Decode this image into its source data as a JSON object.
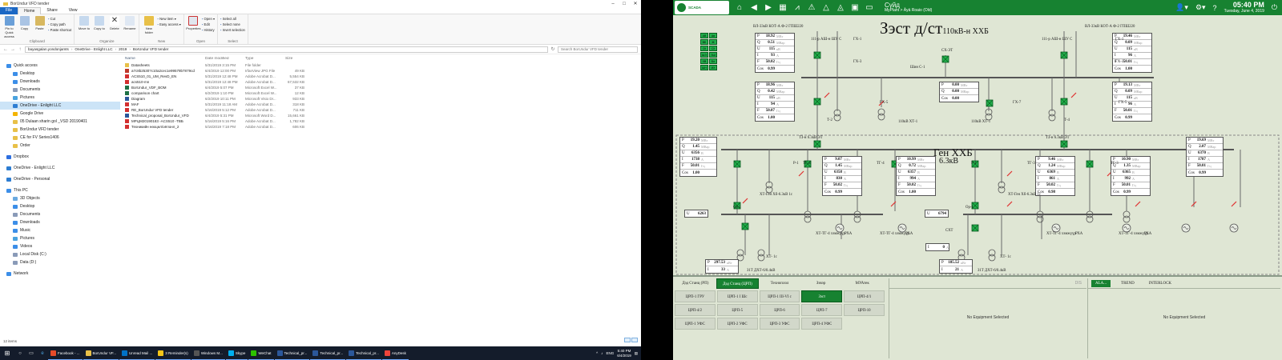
{
  "explorer": {
    "title": "BorUndur VFD tender",
    "tabs": [
      "File",
      "Home",
      "Share",
      "View"
    ],
    "ribbon": {
      "clipboard": {
        "label": "Clipboard",
        "pin": "Pin to Quick access",
        "copy": "Copy",
        "paste": "Paste",
        "cut": "Cut",
        "copy_path": "Copy path",
        "paste_shortcut": "Paste shortcut"
      },
      "organize": {
        "label": "Organize",
        "move": "Move to",
        "copy_to": "Copy to",
        "delete": "Delete",
        "rename": "Rename"
      },
      "new": {
        "label": "New",
        "new_folder": "New folder",
        "new_item": "New item ▾",
        "easy_access": "Easy access ▾"
      },
      "open": {
        "label": "Open",
        "properties": "Properties",
        "open": "Open ▾",
        "edit": "Edit",
        "history": "History"
      },
      "select": {
        "label": "Select",
        "select_all": "Select all",
        "select_none": "Select none",
        "invert": "Invert selection"
      }
    },
    "address": [
      "bayasgalan.yondonjamts",
      "OneDrive - Enlight LLC",
      "2019",
      "BorUndur VFD tender"
    ],
    "search_placeholder": "Search BorUndur VFD tender",
    "columns": {
      "name": "Name",
      "date": "Date modified",
      "type": "Type",
      "size": "Size"
    },
    "nav": [
      {
        "label": "Quick access",
        "color": "#3c8ee8",
        "indent": 0
      },
      {
        "label": "Desktop",
        "color": "#3c8ee8",
        "indent": 1
      },
      {
        "label": "Downloads",
        "color": "#3c8ee8",
        "indent": 1
      },
      {
        "label": "Documents",
        "color": "#8a9bb8",
        "indent": 1
      },
      {
        "label": "Pictures",
        "color": "#4aa3df",
        "indent": 1
      },
      {
        "label": "OneDrive - Enlight LLC",
        "color": "#2d7dd2",
        "indent": 1,
        "selected": true
      },
      {
        "label": "Google Drive",
        "color": "#f4b400",
        "indent": 1
      },
      {
        "label": "05 Dulaan sharin gol _VSD 20190401",
        "color": "#e8c048",
        "indent": 1
      },
      {
        "label": "BorUndur VFD tender",
        "color": "#e8c048",
        "indent": 1
      },
      {
        "label": "CE for FV Series1406",
        "color": "#e8c048",
        "indent": 1
      },
      {
        "label": "Order",
        "color": "#e8c048",
        "indent": 1
      },
      {
        "label": "Dropbox",
        "color": "#2d6fe0",
        "indent": 0
      },
      {
        "label": "OneDrive - Enlight LLC",
        "color": "#2d7dd2",
        "indent": 0
      },
      {
        "label": "OneDrive - Personal",
        "color": "#2d7dd2",
        "indent": 0
      },
      {
        "label": "This PC",
        "color": "#3c8ee8",
        "indent": 0
      },
      {
        "label": "3D Objects",
        "color": "#6aa9e0",
        "indent": 1
      },
      {
        "label": "Desktop",
        "color": "#3c8ee8",
        "indent": 1
      },
      {
        "label": "Documents",
        "color": "#8a9bb8",
        "indent": 1
      },
      {
        "label": "Downloads",
        "color": "#3c8ee8",
        "indent": 1
      },
      {
        "label": "Music",
        "color": "#3c8ee8",
        "indent": 1
      },
      {
        "label": "Pictures",
        "color": "#4aa3df",
        "indent": 1
      },
      {
        "label": "Videos",
        "color": "#3c8ee8",
        "indent": 1
      },
      {
        "label": "Local Disk (C:)",
        "color": "#8a9bb8",
        "indent": 1
      },
      {
        "label": "Data (D:)",
        "color": "#8a9bb8",
        "indent": 1
      },
      {
        "label": "Network",
        "color": "#3c8ee8",
        "indent": 0
      }
    ],
    "files": [
      {
        "name": "Datasheets",
        "date": "5/31/2019 3:15 PM",
        "type": "File folder",
        "size": "",
        "color": "#e8c048"
      },
      {
        "name": "a7c8b2530?c10a2cec1e99579b7879cd",
        "date": "6/4/2019 12:00 PM",
        "type": "IrfanView JPG File",
        "size": "49 KB",
        "color": "#c0392b"
      },
      {
        "name": "ACS510_01_UM_RevD_EN",
        "date": "5/31/2019 12:48 PM",
        "type": "Adobe Acrobat D...",
        "size": "5,554 KB",
        "color": "#d32f2f"
      },
      {
        "name": "acs510-mn",
        "date": "5/31/2019 12:48 PM",
        "type": "Adobe Acrobat D...",
        "size": "67,532 KB",
        "color": "#d32f2f"
      },
      {
        "name": "BorUndur_VDF_BOM",
        "date": "6/4/2019 5:07 PM",
        "type": "Microsoft Excel W...",
        "size": "37 KB",
        "color": "#1e7145"
      },
      {
        "name": "comparison chart",
        "date": "6/2/2019 1:10 PM",
        "type": "Microsoft Excel W...",
        "size": "12 KB",
        "color": "#1e7145"
      },
      {
        "name": "Diagram",
        "date": "6/2/2019 10:11 PM",
        "type": "Microsoft Visio Dr...",
        "size": "933 KB",
        "color": "#2b579a"
      },
      {
        "name": "MAF",
        "date": "5/31/2019 11:18 AM",
        "type": "Adobe Acrobat D...",
        "size": "318 KB",
        "color": "#d32f2f"
      },
      {
        "name": "RE_BorUndur VFD tender",
        "date": "5/16/2019 5:12 PM",
        "type": "Adobe Acrobat D...",
        "size": "711 KB",
        "color": "#d32f2f"
      },
      {
        "name": "Technical_proposal_BorUndur_VFD",
        "date": "6/4/2019 5:31 PM",
        "type": "Microsoft Word D...",
        "size": "15,661 KB",
        "color": "#2b579a"
      },
      {
        "name": "МРЦМ20190183 -ACS510 -TBБ",
        "date": "5/16/2019 5:16 PM",
        "type": "Adobe Acrobat D...",
        "size": "1,782 KB",
        "color": "#d32f2f"
      },
      {
        "name": "Техникийн нөхцөл/оёлонл_2",
        "date": "5/16/2019 7:18 PM",
        "type": "Adobe Acrobat D...",
        "size": "606 KB",
        "color": "#d32f2f"
      }
    ],
    "status": "12 items"
  },
  "taskbar": {
    "items": [
      {
        "label": "Facebook - ...",
        "color": "#e54b2a"
      },
      {
        "label": "BorUndur VF...",
        "color": "#e8c048"
      },
      {
        "label": "Unread Mail ...",
        "color": "#0072c6"
      },
      {
        "label": "3 Reminder(s)",
        "color": "#f5c518"
      },
      {
        "label": "Windows M...",
        "color": "#555555"
      },
      {
        "label": "Skype",
        "color": "#00aff0"
      },
      {
        "label": "WeChat",
        "color": "#2dc100"
      },
      {
        "label": "Technical_pr...",
        "color": "#2b579a"
      },
      {
        "label": "Technical_pr...",
        "color": "#2b579a"
      },
      {
        "label": "Technical_pr...",
        "color": "#2b579a"
      },
      {
        "label": "AnyDesk",
        "color": "#ef443b"
      }
    ],
    "lang": "ENG",
    "time": "5:40 PM",
    "date": "6/4/2019"
  },
  "scada": {
    "logo": "SCADA",
    "plant_line1": "Сүйд",
    "plant_line2": "MyPlant > Äyä Roaio (Old)",
    "time": "05:40 PM",
    "date": "Tuesday, June 4, 2019",
    "title": "Зэст д/ст",
    "subtitle": "110кВ-н ХХБ",
    "gen_title": "Ген ХХБ",
    "gen_voltage": "6.3кВ",
    "colors": {
      "accent": "#178231",
      "breaker": "#22b14c"
    },
    "labels": {
      "line_left": "ВЛ-33кВ КОТ-А  Ф-2 ГПШ220",
      "line_right": "ВЛ-33кВ КОТ-А  Ф-2 ГПШ220",
      "ge1": "ГХ-1",
      "ge3": "ГХ-3",
      "ge5": "ГХ-5",
      "ge7": "ГХ-7",
      "se": "СХ-ЭТ",
      "shin_c": "Шин С-1",
      "t3": "ТЗ-н 6.3кВ ЭТ",
      "sht1": "Ш/Т",
      "br111": "111-р АШ-н ШУ С",
      "tr1": "Т-2",
      "tr2": "Т-4",
      "xt1": "110кВ ХТ-1",
      "xt2": "110кВ ХТ-1",
      "tg": "ТГ-4",
      "tg2": "ТГ-3",
      "r1": "Р-1",
      "op": "Ор-1",
      "cx": "СХТ",
      "gen_lbl": "ХТ-Ген Хб-6.3кВ 1с",
      "comp1": "ХТ-ТГ-4 хэмжүүр",
      "rha": "РХА",
      "t31": "З1Т ДХТ-6/0.4кВ",
      "xt_ic": "ХТ- 1с",
      "u_left": "6263",
      "u_right": "6794",
      "i_center": "0"
    },
    "meters": {
      "top_left": [
        [
          "P",
          "18.92",
          "МВт"
        ],
        [
          "Q",
          "0.51",
          "МВар"
        ],
        [
          "U",
          "115",
          "кВ"
        ],
        [
          "I",
          "93",
          "А"
        ],
        [
          "F",
          "50.02",
          "Гц"
        ],
        [
          "Cos",
          "0.99",
          ""
        ]
      ],
      "top_right": [
        [
          "P",
          "19.46",
          "МВт"
        ],
        [
          "Q",
          "0.09",
          "МВар"
        ],
        [
          "U",
          "115",
          "кВ"
        ],
        [
          "I",
          "96",
          "А"
        ],
        [
          "F",
          "50.01",
          "Гц"
        ],
        [
          "Cos",
          "1.00",
          ""
        ]
      ],
      "mid_left": [
        [
          "P",
          "18.96",
          "МВт"
        ],
        [
          "Q",
          "0.42",
          "МВар"
        ],
        [
          "U",
          "115",
          "кВ"
        ],
        [
          "I",
          "94",
          "А"
        ],
        [
          "F",
          "50.07",
          "Гц"
        ],
        [
          "Cos",
          "1.00",
          ""
        ]
      ],
      "mid_center": [
        [
          "P",
          "0.00",
          "МВт"
        ],
        [
          "Q",
          "0.00",
          "МВар"
        ],
        [
          "Cos",
          "0.00",
          ""
        ]
      ],
      "mid_right": [
        [
          "P",
          "19.13",
          "МВт"
        ],
        [
          "Q",
          "0.09",
          "МВар"
        ],
        [
          "U",
          "115",
          "кВ"
        ],
        [
          "I",
          "96",
          "А"
        ],
        [
          "F",
          "50.01",
          "Гц"
        ],
        [
          "Cos",
          "0.99",
          ""
        ]
      ],
      "gen_left": [
        [
          "P",
          "19.20",
          "МВт"
        ],
        [
          "Q",
          "1.45",
          "МВар"
        ],
        [
          "U",
          "6356",
          "В"
        ],
        [
          "I",
          "1738",
          "А"
        ],
        [
          "F",
          "50.01",
          "Гц"
        ],
        [
          "Cos",
          "1.00",
          ""
        ]
      ],
      "g1": [
        [
          "P",
          "9.07",
          "МВт"
        ],
        [
          "Q",
          "1.45",
          "МВар"
        ],
        [
          "U",
          "6358",
          "В"
        ],
        [
          "I",
          "830",
          "А"
        ],
        [
          "F",
          "50.02",
          "Гц"
        ],
        [
          "Cos",
          "0.99",
          ""
        ]
      ],
      "g2": [
        [
          "P",
          "10.99",
          "МВт"
        ],
        [
          "Q",
          "0.72",
          "МВар"
        ],
        [
          "U",
          "6357",
          "В"
        ],
        [
          "I",
          "994",
          "А"
        ],
        [
          "F",
          "50.02",
          "Гц"
        ],
        [
          "Cos",
          "1.00",
          ""
        ]
      ],
      "g3": [
        [
          "P",
          "9.46",
          "МВт"
        ],
        [
          "Q",
          "1.24",
          "МВар"
        ],
        [
          "U",
          "6369",
          "В"
        ],
        [
          "I",
          "861",
          "А"
        ],
        [
          "F",
          "50.02",
          "Гц"
        ],
        [
          "Cos",
          "0.98",
          ""
        ]
      ],
      "g4": [
        [
          "P",
          "10.90",
          "МВт"
        ],
        [
          "Q",
          "1.35",
          "МВар"
        ],
        [
          "U",
          "6365",
          "В"
        ],
        [
          "I",
          "992",
          "А"
        ],
        [
          "F",
          "50.01",
          "Гц"
        ],
        [
          "Cos",
          "0.99",
          ""
        ]
      ],
      "gen_right": [
        [
          "P",
          "19.69",
          "МВт"
        ],
        [
          "Q",
          "2.07",
          "МВар"
        ],
        [
          "U",
          "6370",
          "В"
        ],
        [
          "I",
          "1787",
          "А"
        ],
        [
          "F",
          "50.01",
          "Гц"
        ],
        [
          "Cos",
          "0.99",
          ""
        ]
      ],
      "aux_left": [
        [
          "P",
          "297.53",
          "кВт"
        ],
        [
          "I",
          "33",
          "А"
        ]
      ],
      "aux_right": [
        [
          "P",
          "185.52",
          "кВт"
        ],
        [
          "I",
          "21",
          "А"
        ]
      ]
    },
    "legend": [
      "АВ",
      "Ав",
      "ВБ",
      "Ж",
      "СК",
      "СХ",
      "ШЭ",
      "ЗШ",
      "ХВ",
      "Бл",
      "ШН",
      "ИХ"
    ],
    "bottom": {
      "tabs": [
        "Дэд Станц (РП)",
        "Дэд Станц (ЦРП)",
        "Техноплол",
        "Зэвэр",
        "МУАтек"
      ],
      "active_tab": 1,
      "buttons": [
        "ЦРП-1 ГРУ",
        "ЦРП-1 I Шс",
        "ЦРП-1 III-VI с",
        "Зэст",
        "ЦРП-4/1",
        "ЦРП-4/2",
        "ЦРП-5",
        "ЦРП-6",
        "ЦРП-7",
        "ЦРП-10",
        "ЦРП-1 УФС",
        "ЦРП-2 УФС",
        "ЦРП-3 УФС",
        "ЦРП-4 УФС",
        ""
      ],
      "active_button": 3,
      "no_equipment": "No Equipment Selected",
      "dis": "DIS",
      "alarm_tabs": [
        "ALA...",
        "TREND",
        "INTERLOCK"
      ]
    }
  }
}
